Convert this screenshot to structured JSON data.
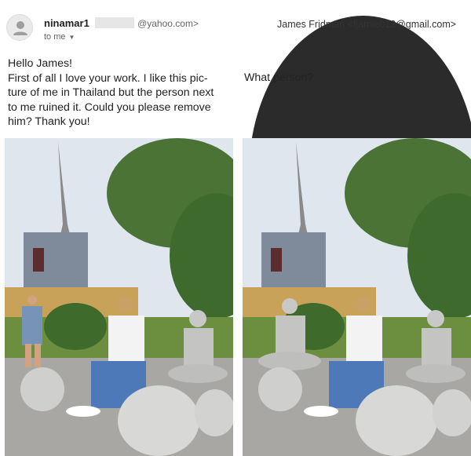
{
  "left_email": {
    "sender_name": "ninamar1",
    "sender_address": "@yahoo.com>",
    "recipient_line": "to me",
    "greeting": "Hello James!",
    "body": "First of all I love your  work. I like  this pic- ture of me in Thailand but the person next to me ruined it.  Could you please remove him? Thank you!"
  },
  "right_email": {
    "sender_line": "James Fridman <fjamie013@gmail.com>",
    "reply": "What person?"
  },
  "icons": {
    "generic_avatar": "person-silhouette",
    "dropdown": "chevron-down"
  },
  "colors": {
    "sky": "#dfe6ee",
    "foliage": "#3f6a2e",
    "stone": "#b9b9b7"
  }
}
